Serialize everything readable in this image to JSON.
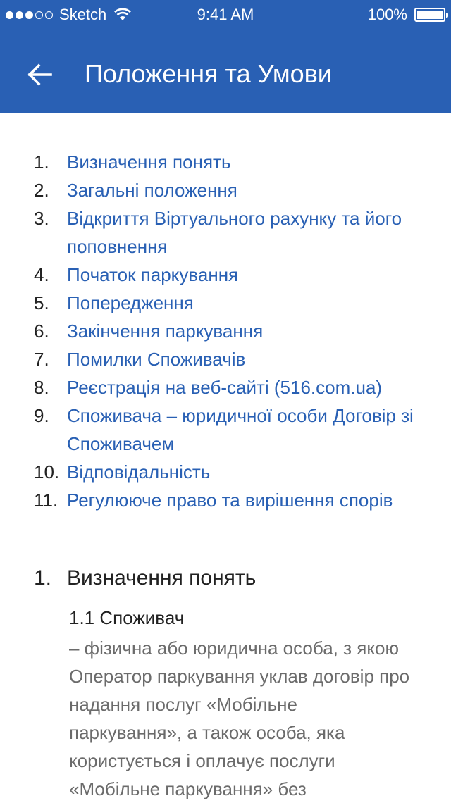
{
  "status_bar": {
    "carrier": "Sketch",
    "time": "9:41 AM",
    "battery": "100%"
  },
  "header": {
    "title": "Положення та Умови",
    "back_icon": "arrow-left-icon"
  },
  "toc": [
    {
      "num": "1.",
      "label": "Визначення понять"
    },
    {
      "num": "2.",
      "label": "Загальні положення"
    },
    {
      "num": "3.",
      "label": "Відкриття Віртуального рахунку та його поповнення"
    },
    {
      "num": "4.",
      "label": "Початок паркування"
    },
    {
      "num": "5.",
      "label": "Попередження"
    },
    {
      "num": "6.",
      "label": "Закінчення паркування"
    },
    {
      "num": "7.",
      "label": "Помилки Споживачів"
    },
    {
      "num": "8.",
      "label": "Реєстрація на веб-сайті (516.com.ua)"
    },
    {
      "num": "9.",
      "label": "Споживача – юридичної особи Договір зі Споживачем"
    },
    {
      "num": "10.",
      "label": "Відповідальність"
    },
    {
      "num": "11.",
      "label": "Регулююче право та вирішення спорів"
    }
  ],
  "section": {
    "num": "1.",
    "title": "Визначення понять",
    "term": "1.1 Споживач",
    "text": " – фізична або юридична особа, з якою Оператор паркування уклав договір про надання послуг «Мобільне паркування», а також особа, яка користується і оплачує послуги «Мобільне паркування» без"
  },
  "colors": {
    "header_bg": "#2960b4",
    "link": "#2960b4",
    "body_text": "#6b6b6b"
  }
}
